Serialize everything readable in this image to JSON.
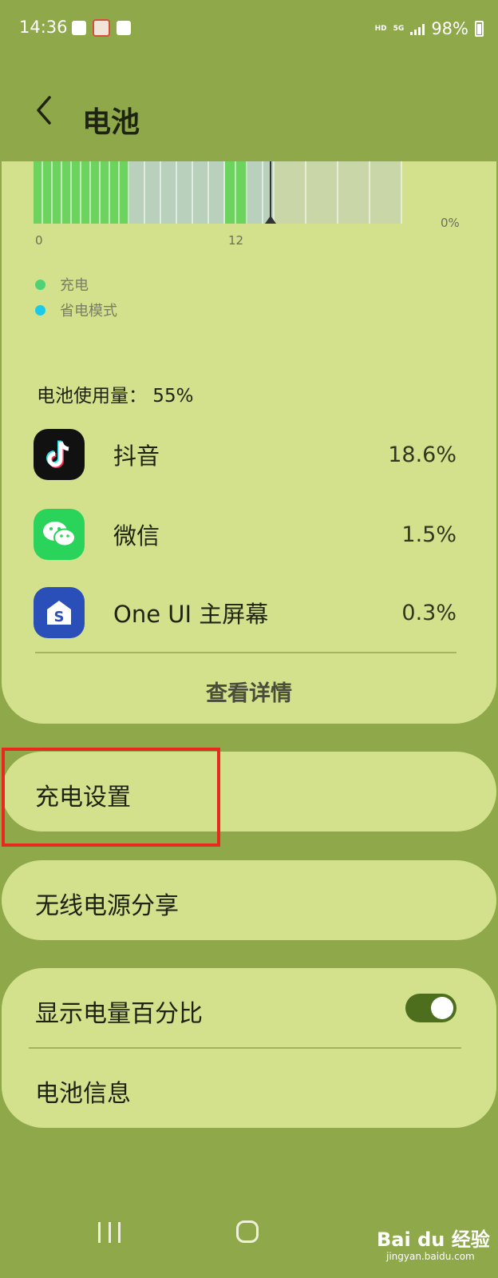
{
  "status_bar": {
    "time": "14:36",
    "hd": "HD",
    "network": "5G",
    "battery_percent": "98%"
  },
  "header": {
    "title": "电池"
  },
  "chart": {
    "x_start": "0",
    "x_mid": "12",
    "y_min": "0%",
    "legend": [
      {
        "label": "充电",
        "color": "#4fd175"
      },
      {
        "label": "省电模式",
        "color": "#1cc9e6"
      }
    ],
    "colors": {
      "charging": "#6cd35e",
      "normal": "#b9d0bd",
      "future": "#c9d7a8"
    }
  },
  "usage": {
    "title": "电池使用量： 55%",
    "apps": [
      {
        "name": "抖音",
        "percent": "18.6%",
        "icon": "tiktok-icon"
      },
      {
        "name": "微信",
        "percent": "1.5%",
        "icon": "wechat-icon"
      },
      {
        "name": "One UI 主屏幕",
        "percent": "0.3%",
        "icon": "oneui-home-icon"
      }
    ],
    "details_button": "查看详情"
  },
  "settings": {
    "charging": "充电设置",
    "wireless_share": "无线电源分享",
    "show_percent": "显示电量百分比",
    "show_percent_on": true,
    "battery_info": "电池信息"
  },
  "watermark": {
    "brand": "Bai du 经验",
    "site": "jingyan.baidu.com"
  }
}
